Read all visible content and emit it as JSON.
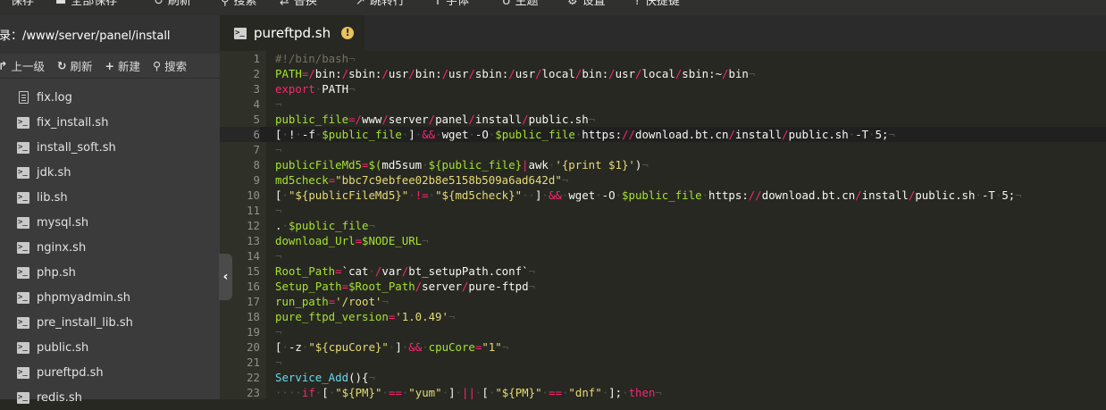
{
  "toolbar": {
    "items": [
      {
        "icon": "save-icon",
        "label": "保存"
      },
      {
        "icon": "save-all-icon",
        "label": "全部保存"
      },
      {
        "icon": "refresh-icon",
        "label": "刷新"
      },
      {
        "icon": "search-icon",
        "label": "搜索"
      },
      {
        "icon": "replace-icon",
        "label": "替换"
      },
      {
        "icon": "jump-icon",
        "label": "跳转行"
      },
      {
        "icon": "font-icon",
        "label": "字体"
      },
      {
        "icon": "theme-icon",
        "label": "主题"
      },
      {
        "icon": "gear-icon",
        "label": "设置"
      },
      {
        "icon": "help-icon",
        "label": "快捷键"
      }
    ]
  },
  "sidebar": {
    "directory_label": "目录：/www/server/panel/install",
    "actions": [
      {
        "icon": "up-arrow-icon",
        "label": "上一级"
      },
      {
        "icon": "refresh-icon",
        "label": "刷新"
      },
      {
        "icon": "plus-icon",
        "label": "新建"
      },
      {
        "icon": "search-icon",
        "label": "搜索"
      }
    ],
    "files": [
      {
        "name": "fix.log",
        "type": "log"
      },
      {
        "name": "fix_install.sh",
        "type": "sh"
      },
      {
        "name": "install_soft.sh",
        "type": "sh"
      },
      {
        "name": "jdk.sh",
        "type": "sh"
      },
      {
        "name": "lib.sh",
        "type": "sh"
      },
      {
        "name": "mysql.sh",
        "type": "sh"
      },
      {
        "name": "nginx.sh",
        "type": "sh"
      },
      {
        "name": "php.sh",
        "type": "sh"
      },
      {
        "name": "phpmyadmin.sh",
        "type": "sh"
      },
      {
        "name": "pre_install_lib.sh",
        "type": "sh"
      },
      {
        "name": "public.sh",
        "type": "sh"
      },
      {
        "name": "pureftpd.sh",
        "type": "sh"
      },
      {
        "name": "redis.sh",
        "type": "sh"
      }
    ]
  },
  "tab": {
    "title": "pureftpd.sh",
    "unsaved_badge": "!"
  },
  "editor": {
    "lines": [
      "#!/bin/bash",
      "PATH=/bin:/sbin:/usr/bin:/usr/sbin:/usr/local/bin:/usr/local/sbin:~/bin",
      "export PATH",
      "",
      "public_file=/www/server/panel/install/public.sh",
      "[ ! -f $public_file ] && wget -O $public_file https://download.bt.cn/install/public.sh -T 5;",
      "",
      "publicFileMd5=$(md5sum ${public_file}|awk '{print $1}')",
      "md5check=\"bbc7c9ebfee02b8e5158b509a6ad642d\"",
      "[ \"${publicFileMd5}\" != \"${md5check}\"  ] && wget -O $public_file https://download.bt.cn/install/public.sh -T 5;",
      "",
      ". $public_file",
      "download_Url=$NODE_URL",
      "",
      "Root_Path=`cat /var/bt_setupPath.conf`",
      "Setup_Path=$Root_Path/server/pure-ftpd",
      "run_path='/root'",
      "pure_ftpd_version='1.0.49'",
      "",
      "[ -z \"${cpuCore}\" ] && cpuCore=\"1\"",
      "",
      "Service_Add(){",
      "    if [ \"${PM}\" == \"yum\" ] || [ \"${PM}\" == \"dnf\" ]; then"
    ]
  },
  "colors": {
    "background": "#272822",
    "keyword": "#f92672",
    "variable": "#a6e22e",
    "string": "#e6db74",
    "comment": "#75715e",
    "function": "#66d9ef",
    "warning_badge": "#e9c45b"
  }
}
